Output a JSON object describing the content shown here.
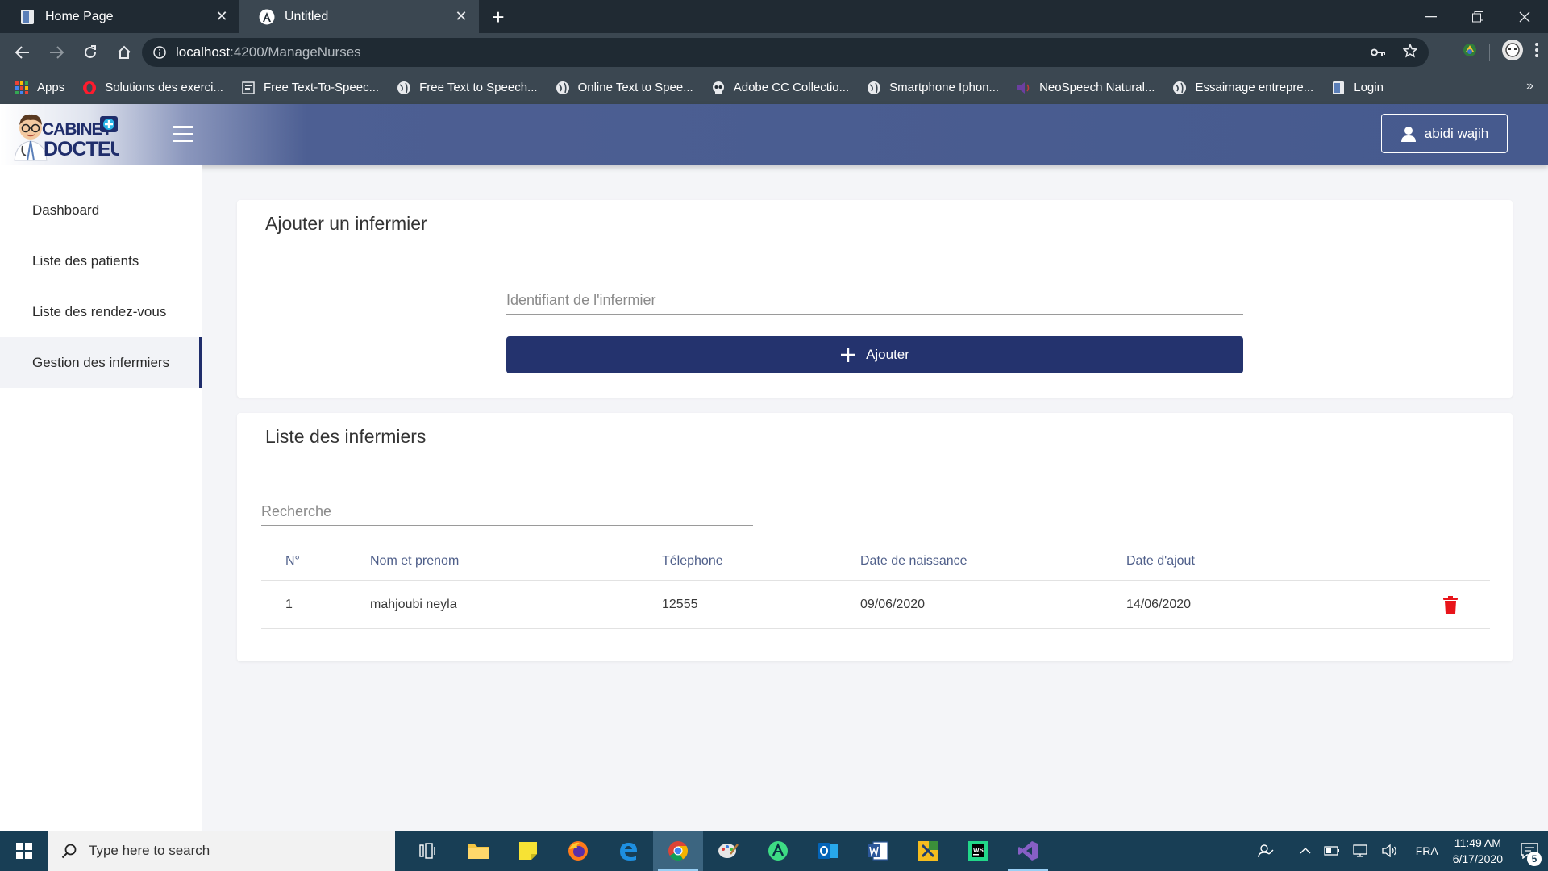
{
  "browser": {
    "tabs": [
      {
        "title": "Home Page",
        "active": false
      },
      {
        "title": "Untitled",
        "active": true
      }
    ],
    "url_host": "localhost",
    "url_path": ":4200/ManageNurses",
    "bookmarks": [
      {
        "label": "Apps",
        "icon": "apps-grid-icon"
      },
      {
        "label": "Solutions des exerci...",
        "icon": "opera-icon"
      },
      {
        "label": "Free Text-To-Speec...",
        "icon": "page-icon"
      },
      {
        "label": "Free Text to Speech...",
        "icon": "globe-icon"
      },
      {
        "label": "Online Text to Spee...",
        "icon": "globe-icon"
      },
      {
        "label": "Adobe CC Collectio...",
        "icon": "skull-icon"
      },
      {
        "label": "Smartphone Iphon...",
        "icon": "globe-icon"
      },
      {
        "label": "NeoSpeech Natural...",
        "icon": "speaker-icon"
      },
      {
        "label": "Essaimage entrepre...",
        "icon": "globe-icon"
      },
      {
        "label": "Login",
        "icon": "document-icon"
      }
    ]
  },
  "header": {
    "user_label": "abidi wajih"
  },
  "sidebar": {
    "items": [
      {
        "label": "Dashboard",
        "active": false
      },
      {
        "label": "Liste des patients",
        "active": false
      },
      {
        "label": "Liste des rendez-vous",
        "active": false
      },
      {
        "label": "Gestion des infermiers",
        "active": true
      }
    ]
  },
  "add_card": {
    "title": "Ajouter un infermier",
    "id_placeholder": "Identifiant de l'infermier",
    "button_label": "Ajouter"
  },
  "list_card": {
    "title": "Liste des infermiers",
    "search_placeholder": "Recherche",
    "columns": [
      "N°",
      "Nom et prenom",
      "Télephone",
      "Date de naissance",
      "Date d'ajout"
    ],
    "rows": [
      {
        "n": "1",
        "name": "mahjoubi neyla",
        "phone": "12555",
        "birth": "09/06/2020",
        "added": "14/06/2020"
      }
    ]
  },
  "taskbar": {
    "search_placeholder": "Type here to search",
    "language": "FRA",
    "time": "11:49 AM",
    "date": "6/17/2020",
    "notification_count": "5"
  },
  "colors": {
    "primary": "#24336e",
    "header": "#465a8e",
    "delete": "#e8141a"
  }
}
